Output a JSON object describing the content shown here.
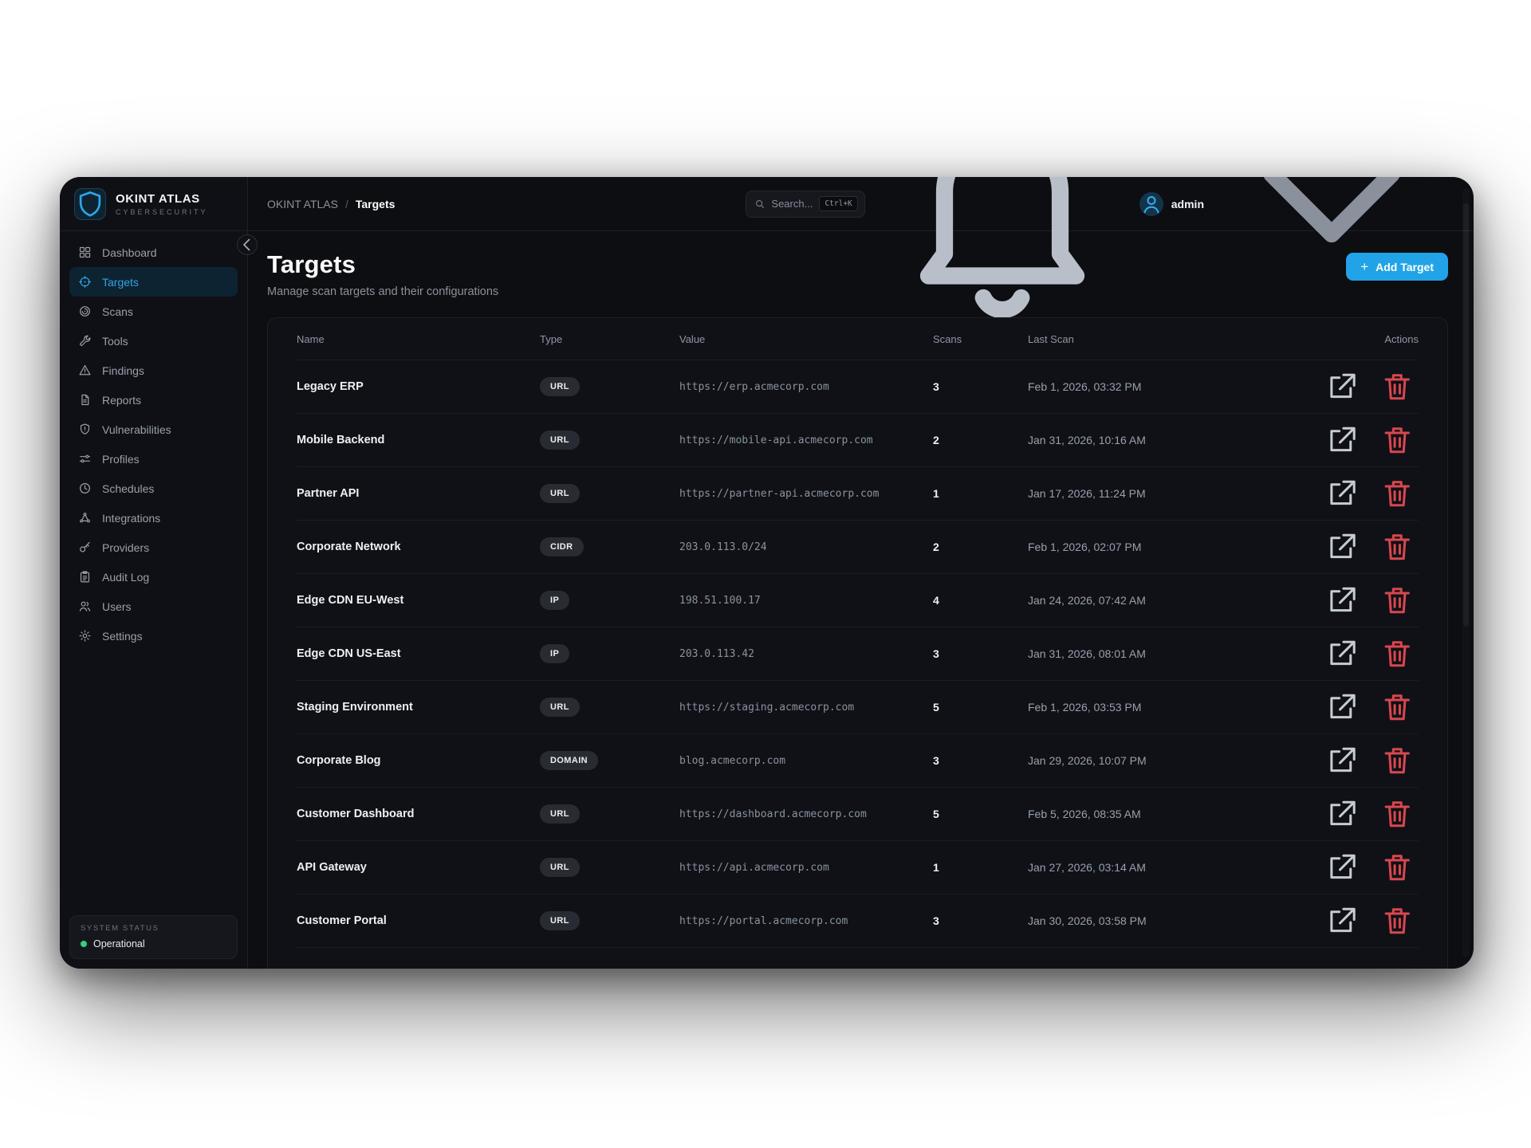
{
  "brand": {
    "name": "OKINT ATLAS",
    "tagline": "CYBERSECURITY"
  },
  "breadcrumb": {
    "root": "OKINT ATLAS",
    "separator": "/",
    "current": "Targets"
  },
  "topbar": {
    "search_placeholder": "Search...",
    "search_shortcut": "Ctrl+K",
    "user_name": "admin"
  },
  "sidebar": {
    "items": [
      {
        "label": "Dashboard",
        "icon": "dashboard-icon",
        "active": false
      },
      {
        "label": "Targets",
        "icon": "target-icon",
        "active": true
      },
      {
        "label": "Scans",
        "icon": "radar-icon",
        "active": false
      },
      {
        "label": "Tools",
        "icon": "wrench-icon",
        "active": false
      },
      {
        "label": "Findings",
        "icon": "warning-triangle-icon",
        "active": false
      },
      {
        "label": "Reports",
        "icon": "document-icon",
        "active": false
      },
      {
        "label": "Vulnerabilities",
        "icon": "shield-alert-icon",
        "active": false
      },
      {
        "label": "Profiles",
        "icon": "sliders-icon",
        "active": false
      },
      {
        "label": "Schedules",
        "icon": "clock-icon",
        "active": false
      },
      {
        "label": "Integrations",
        "icon": "nodes-icon",
        "active": false
      },
      {
        "label": "Providers",
        "icon": "key-icon",
        "active": false
      },
      {
        "label": "Audit Log",
        "icon": "clipboard-icon",
        "active": false
      },
      {
        "label": "Users",
        "icon": "users-icon",
        "active": false
      },
      {
        "label": "Settings",
        "icon": "gear-icon",
        "active": false
      }
    ],
    "status": {
      "heading": "SYSTEM STATUS",
      "value": "Operational"
    }
  },
  "page": {
    "title": "Targets",
    "subtitle": "Manage scan targets and their configurations",
    "add_button_label": "Add Target",
    "add_button_plus": "+"
  },
  "table": {
    "columns": {
      "name": "Name",
      "type": "Type",
      "value": "Value",
      "scans": "Scans",
      "last_scan": "Last Scan",
      "actions": "Actions"
    },
    "rows": [
      {
        "name": "Legacy ERP",
        "type": "URL",
        "value": "https://erp.acmecorp.com",
        "scans": "3",
        "last_scan": "Feb 1, 2026, 03:32 PM"
      },
      {
        "name": "Mobile Backend",
        "type": "URL",
        "value": "https://mobile-api.acmecorp.com",
        "scans": "2",
        "last_scan": "Jan 31, 2026, 10:16 AM"
      },
      {
        "name": "Partner API",
        "type": "URL",
        "value": "https://partner-api.acmecorp.com",
        "scans": "1",
        "last_scan": "Jan 17, 2026, 11:24 PM"
      },
      {
        "name": "Corporate Network",
        "type": "CIDR",
        "value": "203.0.113.0/24",
        "scans": "2",
        "last_scan": "Feb 1, 2026, 02:07 PM"
      },
      {
        "name": "Edge CDN EU-West",
        "type": "IP",
        "value": "198.51.100.17",
        "scans": "4",
        "last_scan": "Jan 24, 2026, 07:42 AM"
      },
      {
        "name": "Edge CDN US-East",
        "type": "IP",
        "value": "203.0.113.42",
        "scans": "3",
        "last_scan": "Jan 31, 2026, 08:01 AM"
      },
      {
        "name": "Staging Environment",
        "type": "URL",
        "value": "https://staging.acmecorp.com",
        "scans": "5",
        "last_scan": "Feb 1, 2026, 03:53 PM"
      },
      {
        "name": "Corporate Blog",
        "type": "DOMAIN",
        "value": "blog.acmecorp.com",
        "scans": "3",
        "last_scan": "Jan 29, 2026, 10:07 PM"
      },
      {
        "name": "Customer Dashboard",
        "type": "URL",
        "value": "https://dashboard.acmecorp.com",
        "scans": "5",
        "last_scan": "Feb 5, 2026, 08:35 AM"
      },
      {
        "name": "API Gateway",
        "type": "URL",
        "value": "https://api.acmecorp.com",
        "scans": "1",
        "last_scan": "Jan 27, 2026, 03:14 AM"
      },
      {
        "name": "Customer Portal",
        "type": "URL",
        "value": "https://portal.acmecorp.com",
        "scans": "3",
        "last_scan": "Jan 30, 2026, 03:58 PM"
      }
    ]
  },
  "colors": {
    "accent": "#22a3e8",
    "danger": "#d9474e",
    "success": "#35d07c"
  }
}
